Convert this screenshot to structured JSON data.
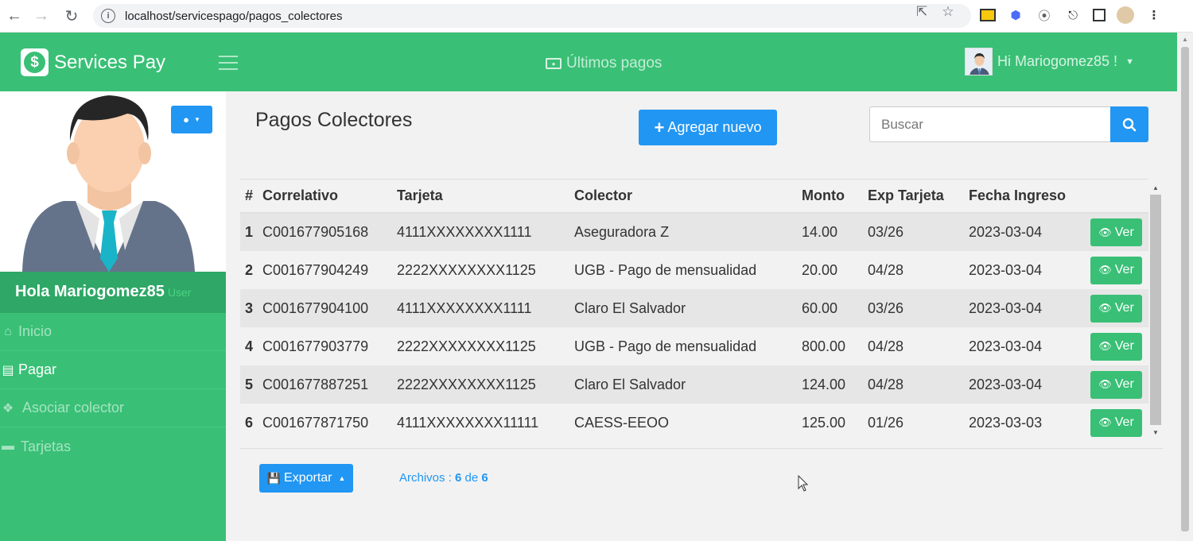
{
  "browser": {
    "url": "localhost/servicespago/pagos_colectores"
  },
  "header": {
    "brand": "Services Pay",
    "center_link": "Últimos pagos",
    "user_greeting": "Hi Mariogomez85 !"
  },
  "sidebar": {
    "hola_name": "Hola Mariogomez85",
    "role": "User",
    "items": [
      {
        "label": "Inicio",
        "icon": "home-icon"
      },
      {
        "label": "Pagar",
        "icon": "money-icon"
      },
      {
        "label": "Asociar colector",
        "icon": "cubes-icon"
      },
      {
        "label": "Tarjetas",
        "icon": "credit-card-icon"
      }
    ]
  },
  "main": {
    "title": "Pagos Colectores",
    "add_button": "Agregar nuevo",
    "search_placeholder": "Buscar",
    "columns": [
      "#",
      "Correlativo",
      "Tarjeta",
      "Colector",
      "Monto",
      "Exp Tarjeta",
      "Fecha Ingreso"
    ],
    "rows": [
      {
        "n": "1",
        "correlativo": "C001677905168",
        "tarjeta": "4111XXXXXXXX1111",
        "colector": "Aseguradora Z",
        "monto": "14.00",
        "exp": "03/26",
        "fecha": "2023-03-04",
        "action": "Ver"
      },
      {
        "n": "2",
        "correlativo": "C001677904249",
        "tarjeta": "2222XXXXXXXX1125",
        "colector": "UGB - Pago de mensualidad",
        "monto": "20.00",
        "exp": "04/28",
        "fecha": "2023-03-04",
        "action": "Ver"
      },
      {
        "n": "3",
        "correlativo": "C001677904100",
        "tarjeta": "4111XXXXXXXX1111",
        "colector": "Claro El Salvador",
        "monto": "60.00",
        "exp": "03/26",
        "fecha": "2023-03-04",
        "action": "Ver"
      },
      {
        "n": "4",
        "correlativo": "C001677903779",
        "tarjeta": "2222XXXXXXXX1125",
        "colector": "UGB - Pago de mensualidad",
        "monto": "800.00",
        "exp": "04/28",
        "fecha": "2023-03-04",
        "action": "Ver"
      },
      {
        "n": "5",
        "correlativo": "C001677887251",
        "tarjeta": "2222XXXXXXXX1125",
        "colector": "Claro El Salvador",
        "monto": "124.00",
        "exp": "04/28",
        "fecha": "2023-03-04",
        "action": "Ver"
      },
      {
        "n": "6",
        "correlativo": "C001677871750",
        "tarjeta": "4111XXXXXXXX11111",
        "colector": "CAESS-EEOO",
        "monto": "125.00",
        "exp": "01/26",
        "fecha": "2023-03-03",
        "action": "Ver"
      }
    ],
    "export_button": "Exportar",
    "archivos_label": "Archivos :",
    "archivos_count": "6",
    "archivos_de": "de",
    "archivos_total": "6"
  },
  "colors": {
    "primary_green": "#39c076",
    "accent_blue": "#2196f3"
  }
}
